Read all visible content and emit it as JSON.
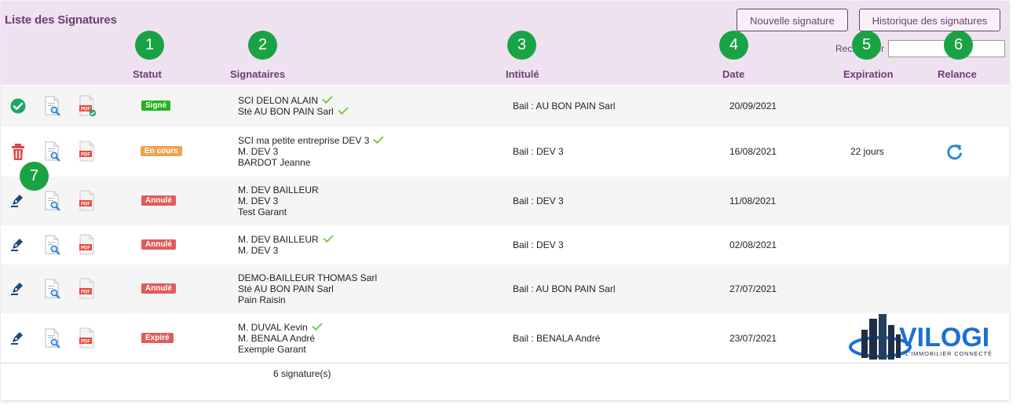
{
  "header": {
    "title": "Liste des Signatures",
    "new_button": "Nouvelle signature",
    "history_button": "Historique des signatures",
    "search_label": "Rechercher"
  },
  "columns": {
    "statut": "Statut",
    "signataires": "Signataires",
    "intitule": "Intitulé",
    "date": "Date",
    "expiration": "Expiration",
    "relance": "Relance"
  },
  "markers": [
    "1",
    "2",
    "3",
    "4",
    "5",
    "6",
    "7"
  ],
  "rows": [
    {
      "status": "Signé",
      "signers": [
        {
          "name": "SCI DELON ALAIN",
          "signed": true
        },
        {
          "name": "Sté AU BON PAIN Sarl",
          "signed": true
        }
      ],
      "intitule": "Bail : AU BON PAIN Sarl",
      "date": "20/09/2021",
      "expiration": "",
      "action_icon": "check-circle-icon"
    },
    {
      "status": "En cours",
      "signers": [
        {
          "name": "SCI ma petite entreprise DEV 3",
          "signed": true
        },
        {
          "name": "M. DEV 3",
          "signed": false
        },
        {
          "name": "BARDOT Jeanne",
          "signed": false
        }
      ],
      "intitule": "Bail : DEV 3",
      "date": "16/08/2021",
      "expiration": "22 jours",
      "action_icon": "trash-icon"
    },
    {
      "status": "Annulé",
      "signers": [
        {
          "name": "M. DEV BAILLEUR",
          "signed": false
        },
        {
          "name": "M. DEV 3",
          "signed": false
        },
        {
          "name": "Test Garant",
          "signed": false
        }
      ],
      "intitule": "Bail : DEV 3",
      "date": "11/08/2021",
      "expiration": "",
      "action_icon": "pen-icon"
    },
    {
      "status": "Annulé",
      "signers": [
        {
          "name": "M. DEV BAILLEUR",
          "signed": true
        },
        {
          "name": "M. DEV 3",
          "signed": false
        }
      ],
      "intitule": "Bail : DEV 3",
      "date": "02/08/2021",
      "expiration": "",
      "action_icon": "pen-icon"
    },
    {
      "status": "Annulé",
      "signers": [
        {
          "name": "DEMO-BAILLEUR THOMAS Sarl",
          "signed": false
        },
        {
          "name": "Sté AU BON PAIN Sarl",
          "signed": false
        },
        {
          "name": "Pain Raisin",
          "signed": false
        }
      ],
      "intitule": "Bail : AU BON PAIN Sarl",
      "date": "27/07/2021",
      "expiration": "",
      "action_icon": "pen-icon"
    },
    {
      "status": "Expiré",
      "signers": [
        {
          "name": "M. DUVAL Kevin",
          "signed": true
        },
        {
          "name": "M. BENALA André",
          "signed": false
        },
        {
          "name": "Exemple Garant",
          "signed": false
        }
      ],
      "intitule": "Bail : BENALA André",
      "date": "23/07/2021",
      "expiration": "",
      "action_icon": "pen-icon"
    }
  ],
  "footer": {
    "count": "6 signature(s)"
  },
  "logo": {
    "name": "VILOGI",
    "tagline": "L'IMMOBILIER CONNECTÉ"
  },
  "colors": {
    "header_bg": "#efe2f0",
    "accent": "#6b3f73",
    "marker": "#1aa345",
    "signed": "#22b21f",
    "in_progress": "#f0a24e",
    "cancelled": "#e35a5a",
    "refresh": "#2a8ad8"
  }
}
